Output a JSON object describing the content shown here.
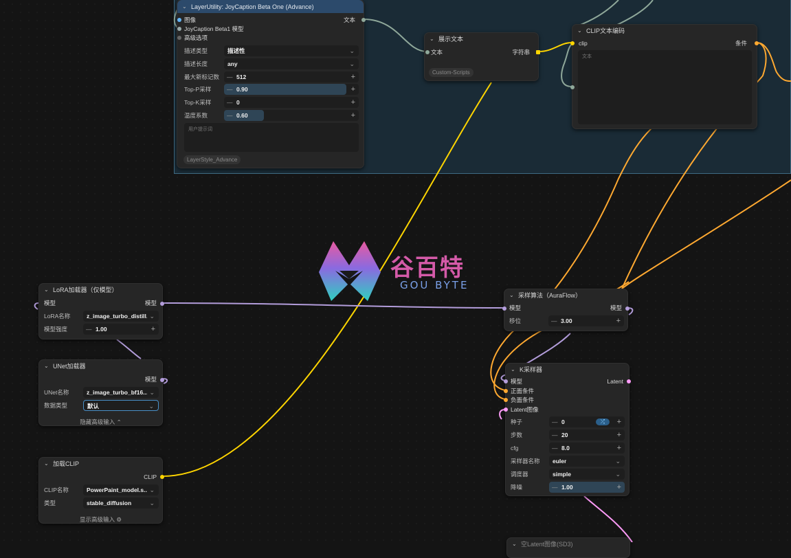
{
  "colors": {
    "clip": "#ffd500",
    "cond": "#ffa931",
    "model": "#b39ddb",
    "latent": "#ff9cf9",
    "text_wire": "#8fa89a",
    "group_bg": "#1a2b36"
  },
  "watermark": {
    "cn": "谷百特",
    "en": "GOU BYTE"
  },
  "joycaption": {
    "title": "LayerUtility: JoyCaption Beta One (Advance)",
    "inputs": [
      "图像",
      "JoyCaption Beta1 模型",
      "高级选项"
    ],
    "output": "文本",
    "widgets": [
      {
        "label": "描述类型",
        "value": "描述性"
      },
      {
        "label": "描述长度",
        "value": "any"
      },
      {
        "label": "最大新标记数",
        "value": "512"
      },
      {
        "label": "Top-P采样",
        "value": "0.90"
      },
      {
        "label": "Top-K采样",
        "value": "0"
      },
      {
        "label": "温度系数",
        "value": "0.60"
      }
    ],
    "prompt_placeholder": "用户提示词",
    "footer_tag": "LayerStyle_Advance"
  },
  "show_text": {
    "title": "展示文本",
    "input": "文本",
    "output": "字符串",
    "footer_tag": "Custom-Scripts"
  },
  "clip_encode": {
    "title": "CLIP文本编码",
    "input": "clip",
    "output": "条件",
    "text_label": "文本"
  },
  "lora": {
    "title": "LoRA加载器（仅模型）",
    "input": "模型",
    "output": "模型",
    "widgets": [
      {
        "label": "LoRA名称",
        "value": "z_image_turbo_distill..."
      },
      {
        "label": "模型强度",
        "value": "1.00"
      }
    ]
  },
  "unet": {
    "title": "UNet加载器",
    "output": "模型",
    "widgets": [
      {
        "label": "UNet名称",
        "value": "z_image_turbo_bf16...."
      },
      {
        "label": "数据类型",
        "value": "默认"
      }
    ],
    "toggle": "隐藏高级输入"
  },
  "clip_loader": {
    "title": "加载CLIP",
    "output": "CLIP",
    "widgets": [
      {
        "label": "CLIP名称",
        "value": "PowerPaint_model.s..."
      },
      {
        "label": "类型",
        "value": "stable_diffusion"
      }
    ],
    "toggle": "显示高级输入"
  },
  "aura": {
    "title": "采样算法（AuraFlow）",
    "input": "模型",
    "output": "模型",
    "widgets": [
      {
        "label": "移位",
        "value": "3.00"
      }
    ]
  },
  "ksampler": {
    "title": "K采样器",
    "inputs": [
      "模型",
      "正面条件",
      "负面条件",
      "Latent图像"
    ],
    "output": "Latent",
    "widgets": [
      {
        "label": "种子",
        "value": "0"
      },
      {
        "label": "步数",
        "value": "20"
      },
      {
        "label": "cfg",
        "value": "8.0"
      },
      {
        "label": "采样器名称",
        "value": "euler"
      },
      {
        "label": "调度器",
        "value": "simple"
      },
      {
        "label": "降噪",
        "value": "1.00"
      }
    ]
  },
  "bottom_node": {
    "title": "空Latent图像(SD3)"
  }
}
